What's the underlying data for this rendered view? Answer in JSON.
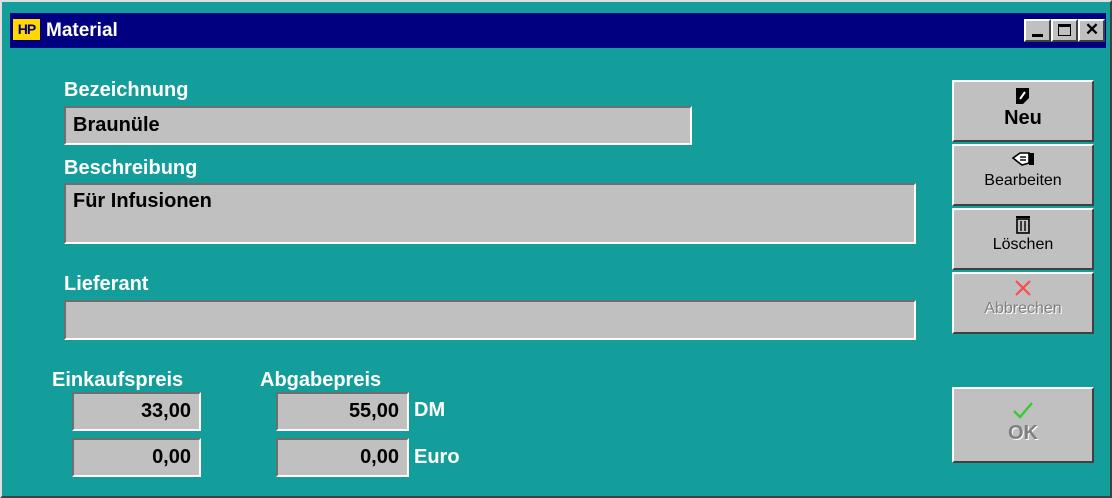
{
  "window": {
    "title": "Material",
    "app_icon_text": "HP",
    "close_glyph": "✕",
    "colors": {
      "background": "#139d9b",
      "titlebar": "#000080",
      "face": "#c0c0c0"
    }
  },
  "form": {
    "bezeichnung": {
      "label": "Bezeichnung",
      "value": "Braunüle"
    },
    "beschreibung": {
      "label": "Beschreibung",
      "value": "Für Infusionen"
    },
    "lieferant": {
      "label": "Lieferant",
      "value": ""
    },
    "einkaufspreis": {
      "label": "Einkaufspreis",
      "dm": "33,00",
      "euro": "0,00"
    },
    "abgabepreis": {
      "label": "Abgabepreis",
      "dm": "55,00",
      "euro": "0,00"
    },
    "currency_dm": "DM",
    "currency_euro": "Euro"
  },
  "buttons": {
    "neu": {
      "label": "Neu",
      "icon": "new-document-icon",
      "enabled": true
    },
    "bearbeiten": {
      "label": "Bearbeiten",
      "icon": "edit-hand-icon",
      "enabled": true
    },
    "loeschen": {
      "label": "Löschen",
      "icon": "trash-icon",
      "enabled": true
    },
    "abbrechen": {
      "label": "Abbrechen",
      "icon": "cancel-x-icon",
      "enabled": false
    },
    "ok": {
      "label": "OK",
      "icon": "checkmark-icon",
      "enabled": false
    }
  }
}
